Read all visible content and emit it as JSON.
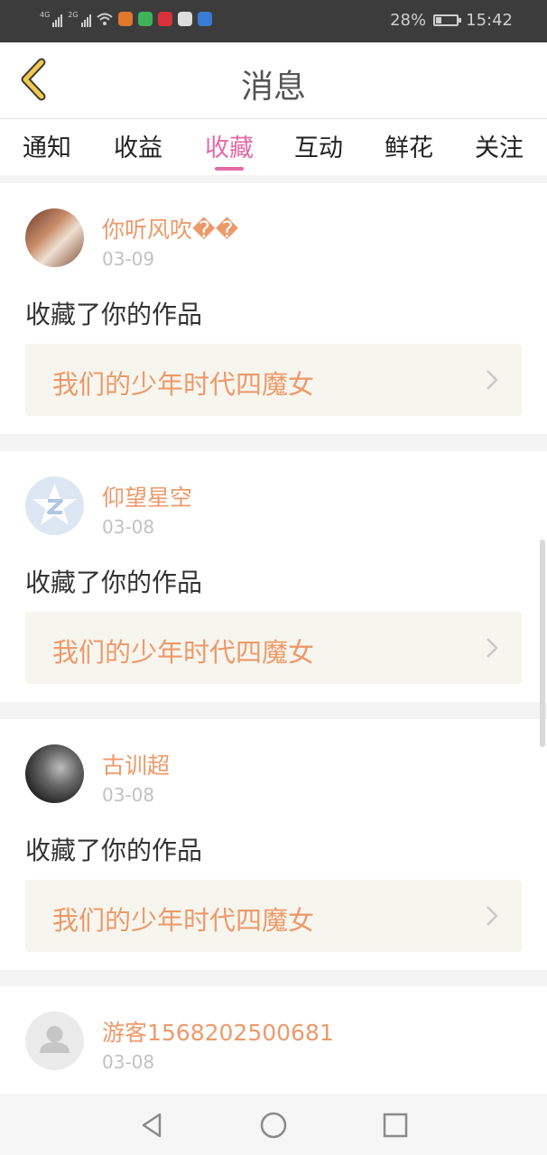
{
  "status_bar": {
    "battery": "28%",
    "battery_level": 0.28,
    "time": "15:42",
    "signal_1": "4G",
    "signal_2": "2G"
  },
  "header": {
    "title": "消息"
  },
  "tabs": [
    {
      "label": "通知",
      "active": false
    },
    {
      "label": "收益",
      "active": false
    },
    {
      "label": "收藏",
      "active": true
    },
    {
      "label": "互动",
      "active": false
    },
    {
      "label": "鲜花",
      "active": false
    },
    {
      "label": "关注",
      "active": false
    }
  ],
  "messages": [
    {
      "user": "你听风吹��",
      "date": "03-09",
      "action": "收藏了你的作品",
      "work": "我们的少年时代四魔女"
    },
    {
      "user": "仰望星空",
      "date": "03-08",
      "action": "收藏了你的作品",
      "work": "我们的少年时代四魔女"
    },
    {
      "user": "古训超",
      "date": "03-08",
      "action": "收藏了你的作品",
      "work": "我们的少年时代四魔女"
    },
    {
      "user": "游客1568202500681",
      "date": "03-08"
    }
  ],
  "colors": {
    "accent_pink": "#e36aa6",
    "accent_orange": "#ec9a6a",
    "back_arrow": "#f2c94c"
  }
}
